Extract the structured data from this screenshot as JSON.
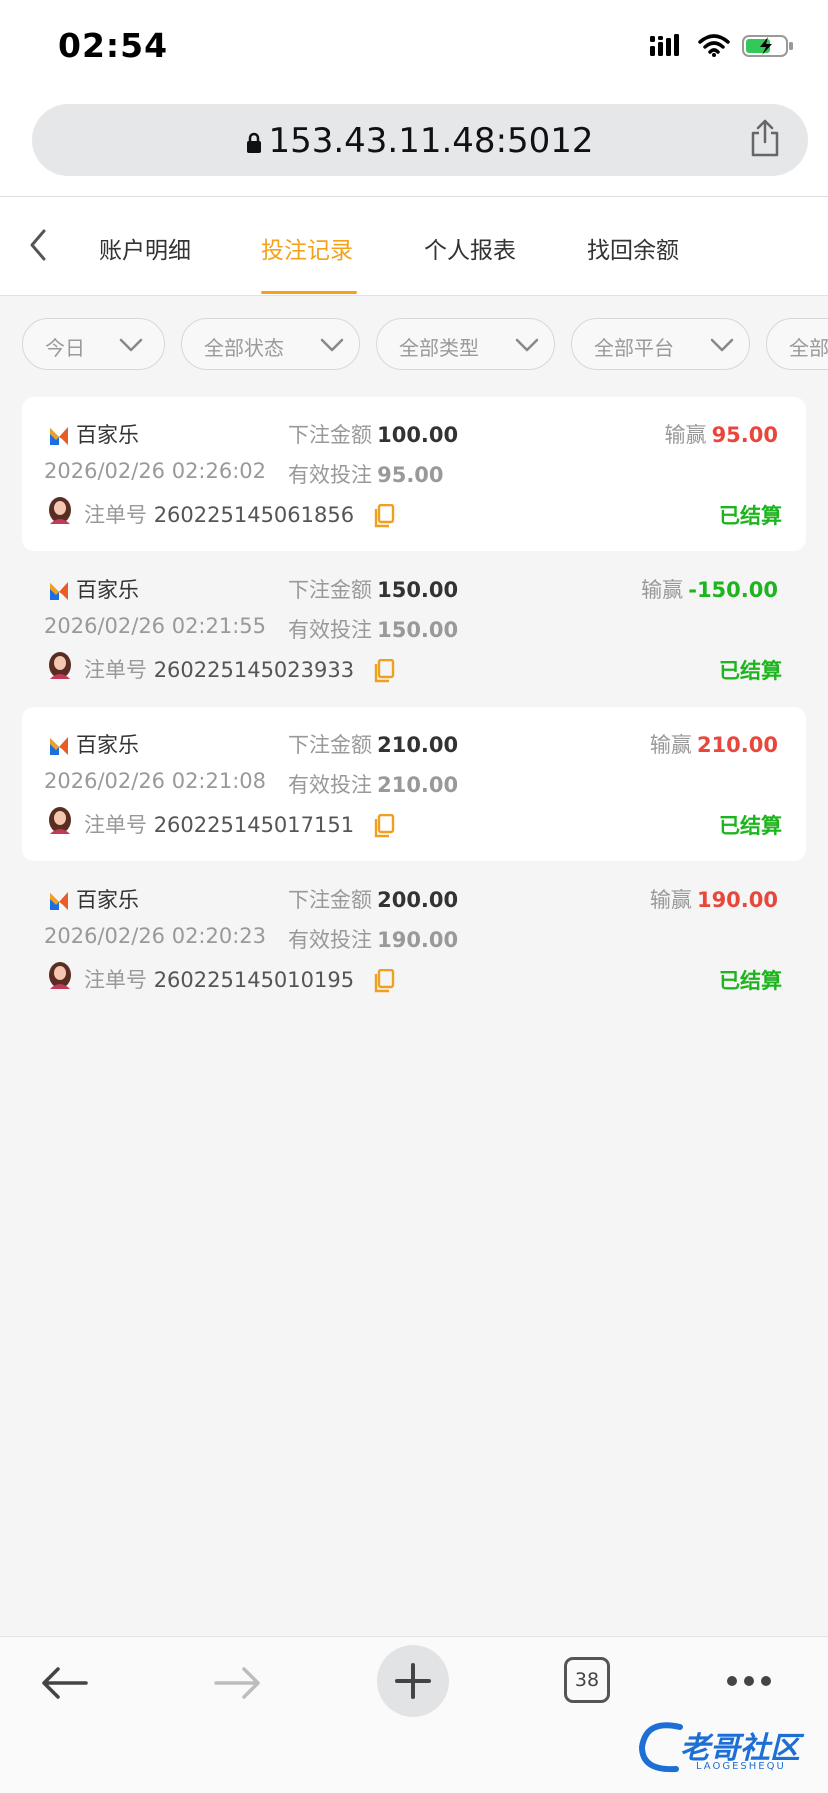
{
  "status_bar": {
    "time": "02:54"
  },
  "browser": {
    "url": "153.43.11.48:5012",
    "tab_count": "38"
  },
  "tabs": [
    {
      "label": "账户明细"
    },
    {
      "label": "投注记录"
    },
    {
      "label": "个人报表"
    },
    {
      "label": "找回余额"
    }
  ],
  "active_tab": "投注记录",
  "filters": [
    {
      "label": "今日"
    },
    {
      "label": "全部状态"
    },
    {
      "label": "全部类型"
    },
    {
      "label": "全部平台"
    },
    {
      "label": "全部"
    }
  ],
  "labels": {
    "bet_amount": "下注金额",
    "valid_bet": "有效投注",
    "win_loss": "输赢",
    "order_no": "注单号"
  },
  "records": [
    {
      "game": "百家乐",
      "time": "2026/02/26 02:26:02",
      "bet": "100.00",
      "valid": "95.00",
      "win_loss": "95.00",
      "order": "260225145061856",
      "status": "已结算"
    },
    {
      "game": "百家乐",
      "time": "2026/02/26 02:21:55",
      "bet": "150.00",
      "valid": "150.00",
      "win_loss": "-150.00",
      "order": "260225145023933",
      "status": "已结算"
    },
    {
      "game": "百家乐",
      "time": "2026/02/26 02:21:08",
      "bet": "210.00",
      "valid": "210.00",
      "win_loss": "210.00",
      "order": "260225145017151",
      "status": "已结算"
    },
    {
      "game": "百家乐",
      "time": "2026/02/26 02:20:23",
      "bet": "200.00",
      "valid": "190.00",
      "win_loss": "190.00",
      "order": "260225145010195",
      "status": "已结算"
    }
  ],
  "colors": {
    "accent": "#f4a21a",
    "win": "#e8473b",
    "loss": "#1db41d",
    "settled": "#1db41d"
  },
  "watermark": {
    "text": "老哥社区",
    "sub": "LAOGESHEQU"
  }
}
